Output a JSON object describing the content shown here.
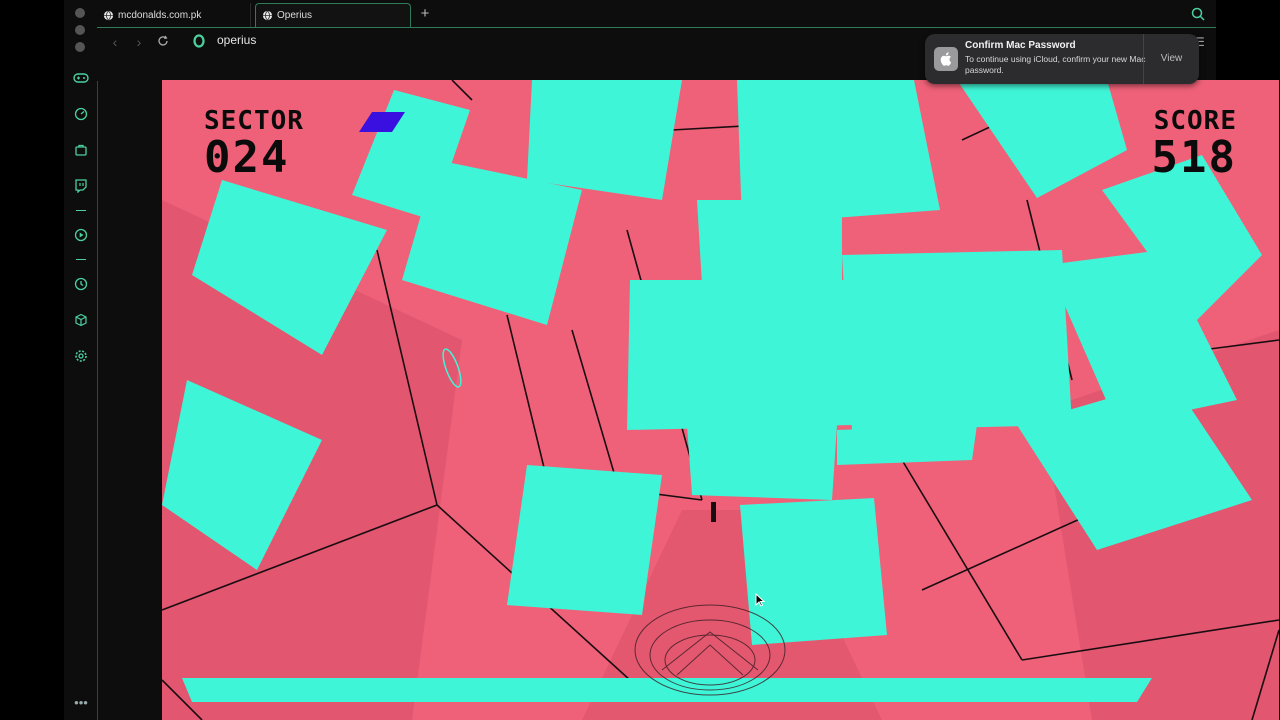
{
  "browser": {
    "tabs": [
      {
        "title": "mcdonalds.com.pk",
        "active": false
      },
      {
        "title": "Operius",
        "active": true
      }
    ],
    "new_tab_label": "+",
    "address": "operius",
    "accent_color": "#4bd1a0"
  },
  "sidebar_icons": [
    "gamepad-icon",
    "speedometer-icon",
    "bag-icon",
    "twitch-icon",
    "play-icon",
    "clock-icon",
    "cube-icon",
    "gear-icon",
    "more-icon"
  ],
  "game": {
    "sector_label": "SECTOR",
    "sector_value": "024",
    "score_label": "SCORE",
    "score_value": "518",
    "colors": {
      "background": "#ef6178",
      "tiles": "#3ff5d7",
      "wire": "#1a0d12",
      "ship": "#3a10e0"
    }
  },
  "notification": {
    "title": "Confirm Mac Password",
    "body": "To continue using iCloud, confirm your new Mac password.",
    "action": "View"
  }
}
